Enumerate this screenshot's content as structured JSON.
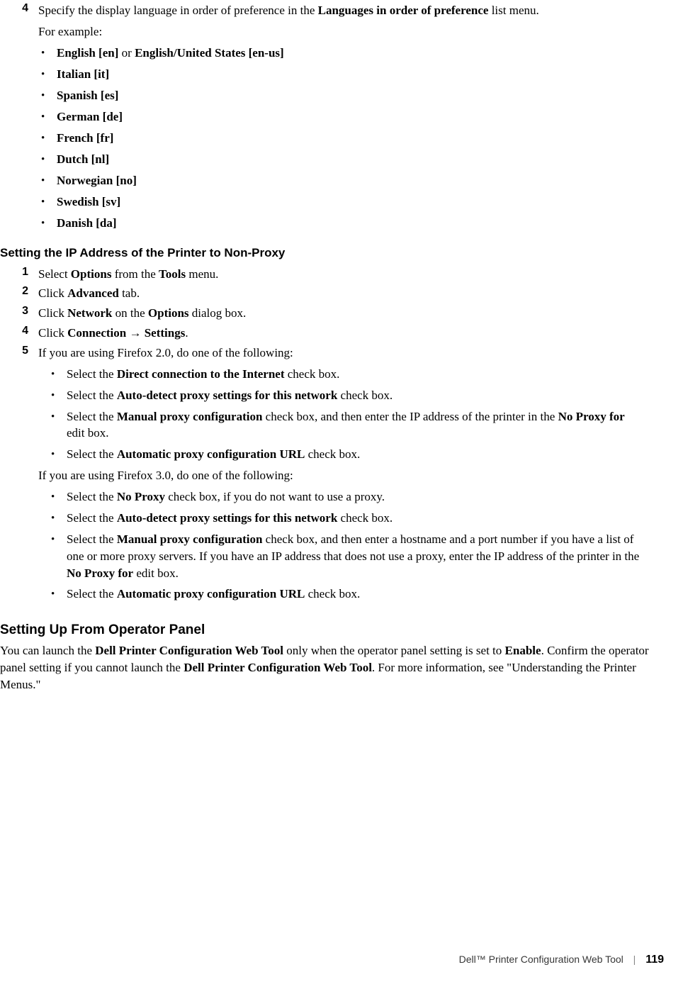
{
  "step4": {
    "num": "4",
    "line_pre": "Specify the display language in order of preference in the ",
    "line_bold": "Languages in order of preference",
    "line_post": " list menu.",
    "for_example": "For example:",
    "langs": [
      {
        "bold": "English [en]",
        "mid": " or ",
        "bold2": "English/United States [en-us]"
      },
      {
        "bold": "Italian [it]"
      },
      {
        "bold": "Spanish [es]"
      },
      {
        "bold": "German [de]"
      },
      {
        "bold": "French [fr]"
      },
      {
        "bold": "Dutch [nl]"
      },
      {
        "bold": "Norwegian [no]"
      },
      {
        "bold": "Swedish [sv]"
      },
      {
        "bold": "Danish [da]"
      }
    ]
  },
  "nonproxy": {
    "heading": "Setting the IP Address of the Printer to Non-Proxy",
    "steps": [
      {
        "num": "1",
        "parts": [
          {
            "t": "Select "
          },
          {
            "b": "Options"
          },
          {
            "t": " from the "
          },
          {
            "b": "Tools"
          },
          {
            "t": " menu."
          }
        ]
      },
      {
        "num": "2",
        "parts": [
          {
            "t": "Click "
          },
          {
            "b": "Advanced"
          },
          {
            "t": " tab."
          }
        ]
      },
      {
        "num": "3",
        "parts": [
          {
            "t": "Click "
          },
          {
            "b": "Network"
          },
          {
            "t": " on the "
          },
          {
            "b": "Options"
          },
          {
            "t": " dialog box."
          }
        ]
      },
      {
        "num": "4",
        "parts": [
          {
            "t": "Click "
          },
          {
            "b": "Connection"
          },
          {
            "t": " "
          },
          {
            "arrow": "→"
          },
          {
            "t": " "
          },
          {
            "b": "Settings"
          },
          {
            "t": "."
          }
        ]
      },
      {
        "num": "5",
        "parts": [
          {
            "t": "If you are using Firefox 2.0, do one of the following:"
          }
        ],
        "ff2": [
          {
            "parts": [
              {
                "t": "Select the "
              },
              {
                "b": "Direct connection to the Internet"
              },
              {
                "t": " check box."
              }
            ]
          },
          {
            "parts": [
              {
                "t": "Select the "
              },
              {
                "b": "Auto-detect proxy settings for this network"
              },
              {
                "t": " check box."
              }
            ]
          },
          {
            "parts": [
              {
                "t": "Select the "
              },
              {
                "b": "Manual proxy configuration"
              },
              {
                "t": " check box, and then enter the IP address of the printer in the "
              },
              {
                "b": "No Proxy for"
              },
              {
                "t": " edit box."
              }
            ]
          },
          {
            "parts": [
              {
                "t": "Select the "
              },
              {
                "b": "Automatic proxy configuration URL"
              },
              {
                "t": " check box."
              }
            ]
          }
        ],
        "ff3_intro": "If you are using Firefox 3.0, do one of the following:",
        "ff3": [
          {
            "parts": [
              {
                "t": "Select the "
              },
              {
                "b": "No Proxy"
              },
              {
                "t": " check box, if you do not want to use a proxy."
              }
            ]
          },
          {
            "parts": [
              {
                "t": "Select the "
              },
              {
                "b": "Auto-detect proxy settings for this network"
              },
              {
                "t": " check box."
              }
            ]
          },
          {
            "parts": [
              {
                "t": "Select the "
              },
              {
                "b": "Manual proxy configuration"
              },
              {
                "t": " check box, and then enter a hostname and a port number if you have a list of one or more proxy servers. If you have an IP address that does not use a proxy, enter the IP address of the printer in the "
              },
              {
                "b": "No Proxy for"
              },
              {
                "t": " edit box."
              }
            ]
          },
          {
            "parts": [
              {
                "t": "Select the "
              },
              {
                "b": "Automatic proxy configuration URL"
              },
              {
                "t": " check box."
              }
            ]
          }
        ]
      }
    ]
  },
  "operator": {
    "heading": "Setting Up From Operator Panel",
    "parts": [
      {
        "t": "You can launch the "
      },
      {
        "b": "Dell Printer Configuration Web Tool"
      },
      {
        "t": " only when the operator panel setting is set to "
      },
      {
        "b": "Enable"
      },
      {
        "t": ". Confirm the operator panel setting if you cannot launch the "
      },
      {
        "b": "Dell Printer Configuration Web Tool"
      },
      {
        "t": ". For more information, see \"Understanding the Printer Menus.\""
      }
    ]
  },
  "footer": {
    "doc": "Dell™ Printer Configuration Web Tool",
    "page": "119"
  }
}
